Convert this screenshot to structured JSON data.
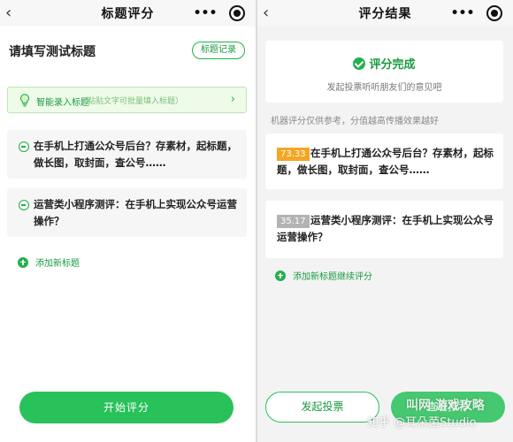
{
  "left_screen": {
    "nav": {
      "back_icon": "chevron-left-icon",
      "title": "标题评分",
      "more": "•••",
      "close_icon": "record-circle-icon"
    },
    "section_title": "请填写测试标题",
    "history_button": "标题记录",
    "smart_entry": {
      "icon": "lightbulb-icon",
      "label": "智能录入标题",
      "hint": "（粘贴文字可批量填入标题）",
      "arrow_icon": "chevron-right-icon"
    },
    "titles": [
      {
        "text": "在手机上打通公众号后台？存素材，起标题，做长图，取封面，查公号……"
      },
      {
        "text": "运营类小程序测评：在手机上实现公众号运营操作？"
      }
    ],
    "add_title_label": "添加新标题",
    "start_button": "开始评分"
  },
  "right_screen": {
    "nav": {
      "back_icon": "chevron-left-icon",
      "title": "评分结果",
      "more": "•••",
      "close_icon": "record-circle-icon"
    },
    "done_title": "评分完成",
    "done_subtitle": "发起投票听听朋友们的意见吧",
    "note": "机器评分仅供参考，分值越高传播效果越好",
    "results": [
      {
        "score": "73.33",
        "text": "在手机上打通公众号后台？存素材，起标题，做长图，取封面，查公号……"
      },
      {
        "score": "35.17",
        "text": "运营类小程序测评：在手机上实现公众号运营操作？"
      }
    ],
    "add_more_label": "添加新标题继续评分",
    "invite_vote_button": "发起投票",
    "second_button": "查看推荐"
  },
  "watermarks": {
    "zhihu": "知乎 @耳朵菌Studio",
    "site": "叫网 游戏攻略"
  },
  "colors": {
    "brand_green": "#29c15a",
    "score_high": "#f5a623",
    "score_low": "#b3b3b3"
  }
}
